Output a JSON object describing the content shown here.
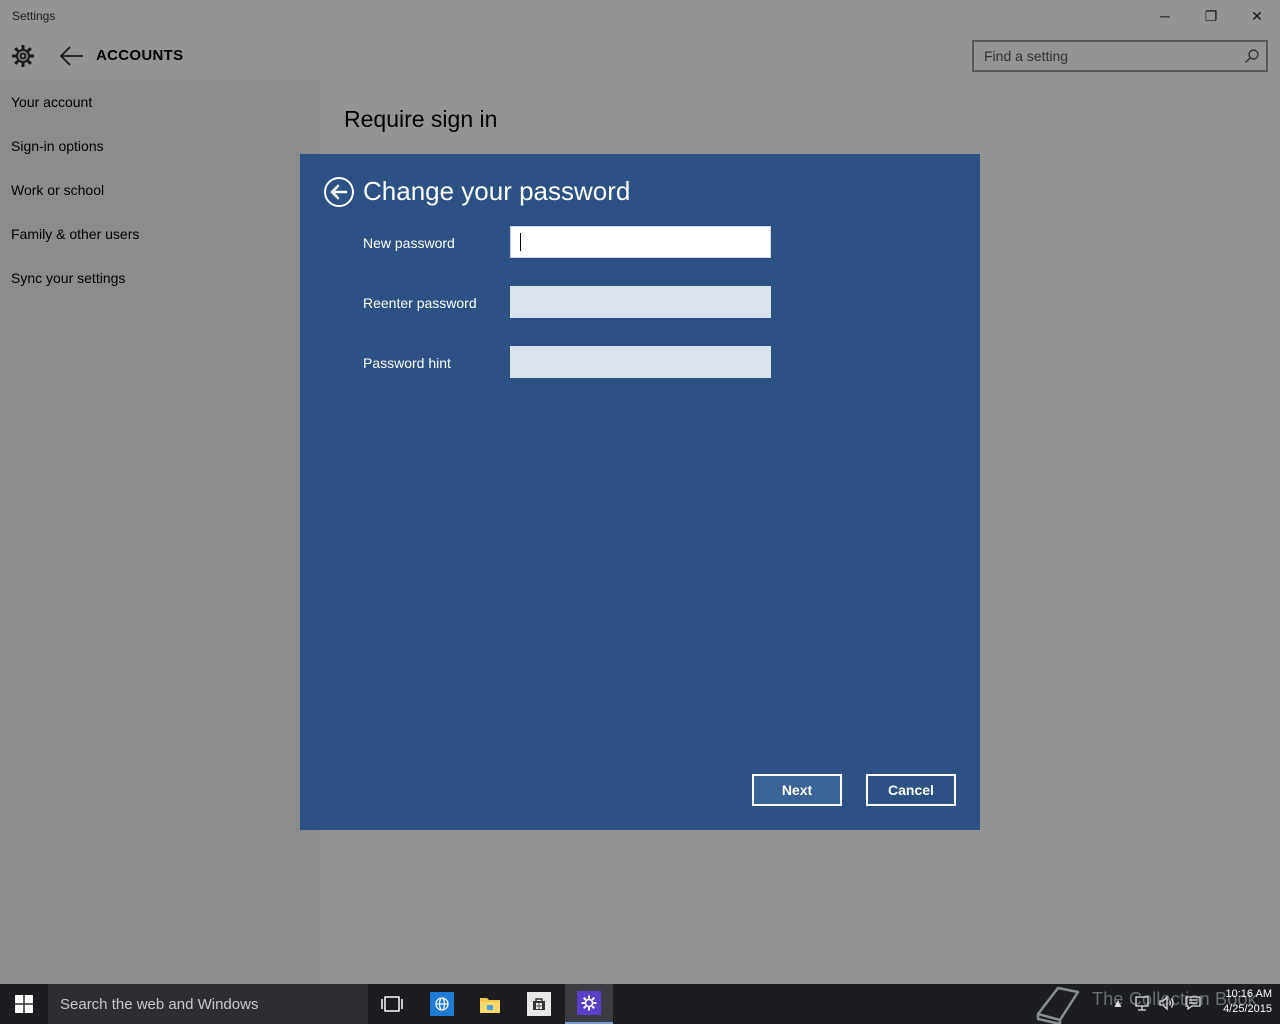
{
  "window": {
    "title": "Settings",
    "controls": {
      "minimize": "─",
      "restore": "❐",
      "close": "✕"
    }
  },
  "header": {
    "section_title": "ACCOUNTS",
    "search_placeholder": "Find a setting"
  },
  "sidebar": {
    "items": [
      {
        "label": "Your account"
      },
      {
        "label": "Sign-in options"
      },
      {
        "label": "Work or school"
      },
      {
        "label": "Family & other users"
      },
      {
        "label": "Sync your settings"
      }
    ]
  },
  "content": {
    "title": "Require sign in"
  },
  "dialog": {
    "title": "Change your password",
    "fields": [
      {
        "label": "New password",
        "value": ""
      },
      {
        "label": "Reenter password",
        "value": ""
      },
      {
        "label": "Password hint",
        "value": ""
      }
    ],
    "next_label": "Next",
    "cancel_label": "Cancel",
    "background_color": "#2d5185"
  },
  "taskbar": {
    "search_text": "Search the web and Windows",
    "watermark": "The Collection Book",
    "clock": {
      "time": "10:16 AM",
      "date": "4/25/2015"
    },
    "apps": [
      "task-view-icon",
      "browser-icon",
      "file-explorer-icon",
      "store-icon",
      "settings-icon"
    ]
  }
}
